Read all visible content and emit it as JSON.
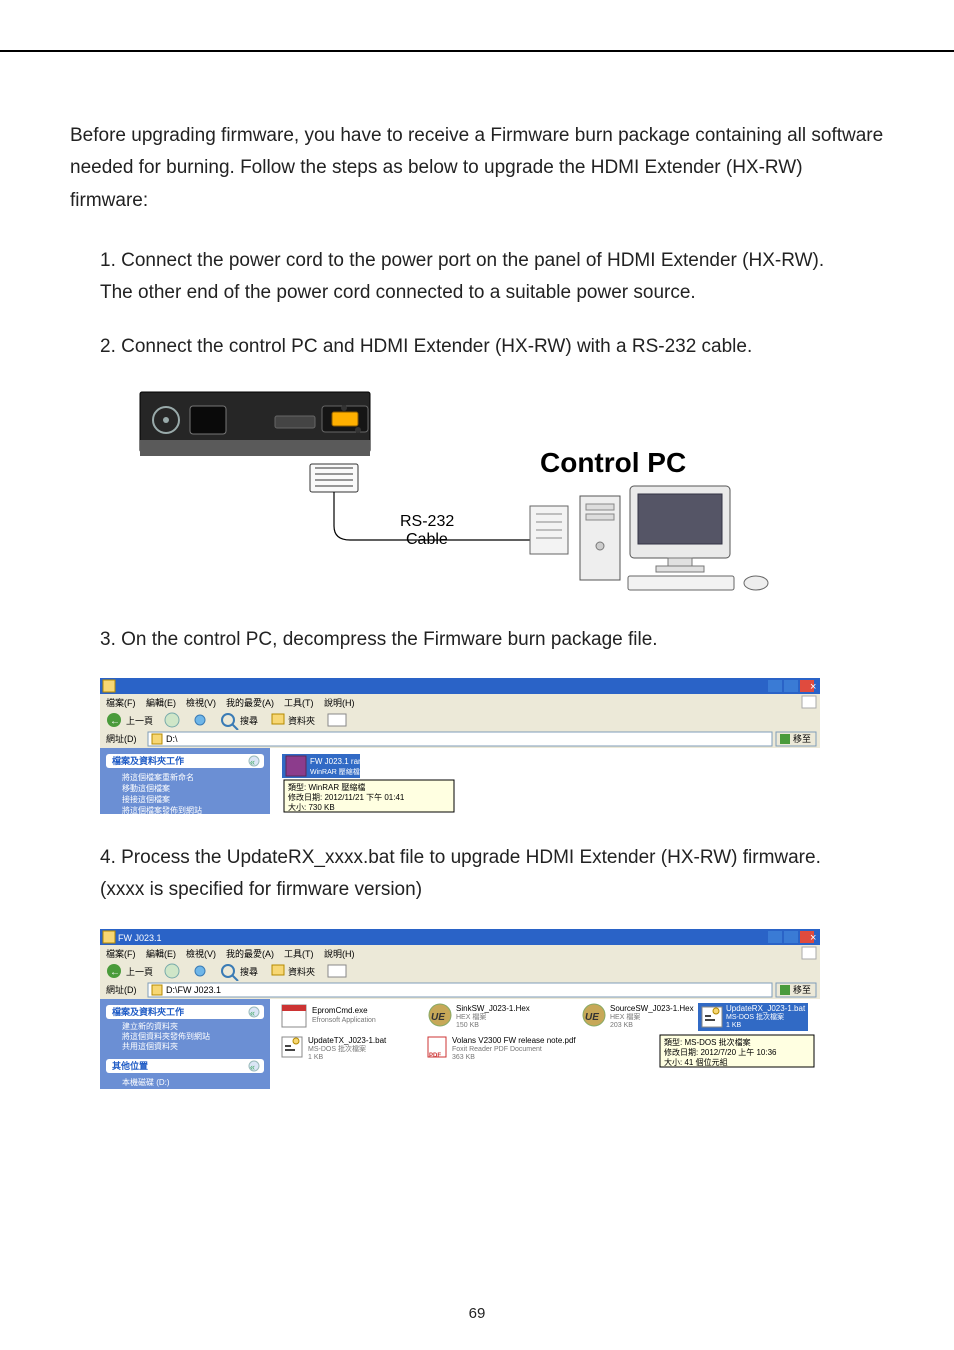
{
  "intro": "Before upgrading firmware, you have to receive a Firmware burn package containing all software needed for burning. Follow the steps as below to upgrade the HDMI Extender (HX-RW) firmware:",
  "steps": {
    "s1a": "1.  Connect the power cord to the power port on the panel of HDMI Extender (HX-RW).",
    "s1b": "The other end of the power cord connected to a suitable power source.",
    "s2": "2.  Connect the control PC and HDMI Extender (HX-RW) with a RS-232 cable.",
    "s3": "3.  On the control PC, decompress the Firmware burn package file.",
    "s4a": "4.  Process the UpdateRX_xxxx.bat file to upgrade HDMI Extender (HX-RW) firmware.",
    "s4b": "(xxxx is specified for firmware version)"
  },
  "diagram": {
    "control_pc_label": "Control PC",
    "cable_label1": "RS-232",
    "cable_label2": "Cable"
  },
  "screenshot1": {
    "menu": {
      "file": "檔案(F)",
      "edit": "編輯(E)",
      "view": "檢視(V)",
      "fav": "我的最愛(A)",
      "tools": "工具(T)",
      "help": "說明(H)"
    },
    "toolbar": {
      "back": "上一頁",
      "search": "搜尋",
      "folders": "資料夾"
    },
    "address_label": "網址(D)",
    "address_value": "D:\\",
    "go": "移至",
    "sidebar_header": "檔案及資料夾工作",
    "sidebar_items": [
      "將這個檔案重新命名",
      "移動這個檔案",
      "接接這個檔案",
      "將這個檔案發佈到網站"
    ],
    "archive": {
      "name": "FW J023.1 rar",
      "size_line": "WinRAR 壓縮檔",
      "type_label": "類型: WinRAR 壓縮檔",
      "date_label": "修改日期: 2012/11/21 下午 01:41",
      "size_label": "大小: 730 KB"
    }
  },
  "screenshot2": {
    "title": "FW J023.1",
    "menu": {
      "file": "檔案(F)",
      "edit": "編輯(E)",
      "view": "檢視(V)",
      "fav": "我的最愛(A)",
      "tools": "工具(T)",
      "help": "說明(H)"
    },
    "toolbar": {
      "back": "上一頁",
      "search": "搜尋",
      "folders": "資料夾"
    },
    "address_label": "網址(D)",
    "address_value": "D:\\FW J023.1",
    "go": "移至",
    "sidebar_header": "檔案及資料夾工作",
    "sidebar_items": [
      "建立新的資料夾",
      "將這個資料夾發佈到網站",
      "共用這個資料夾"
    ],
    "sidebar_header2": "其他位置",
    "sidebar_items2": [
      "本機磁碟 (D:)"
    ],
    "files": {
      "f1": {
        "name": "EpromCmd.exe",
        "sub": "Efronsoft Application"
      },
      "f2": {
        "name": "SinkSW_J023-1.Hex",
        "sub": "HEX 檔案",
        "size": "150 KB"
      },
      "f3": {
        "name": "SourceSW_J023-1.Hex",
        "sub": "HEX 檔案",
        "size": "203 KB"
      },
      "f4": {
        "name": "UpdateRX_J023-1.bat",
        "sub": "MS-DOS 批次檔案",
        "size": "1 KB"
      },
      "f5": {
        "name": "UpdateTX_J023-1.bat",
        "sub": "MS-DOS 批次檔案",
        "size": "1 KB"
      },
      "f6": {
        "name": "Volans V2300 FW release note.pdf",
        "sub": "Foxit Reader PDF Document",
        "size": "363 KB"
      }
    },
    "tooltip": {
      "type_label": "類型: MS-DOS 批次檔案",
      "date_label": "修改日期: 2012/7/20 上午 10:36",
      "size_label": "大小: 41 個位元組"
    }
  },
  "page_number": "69"
}
